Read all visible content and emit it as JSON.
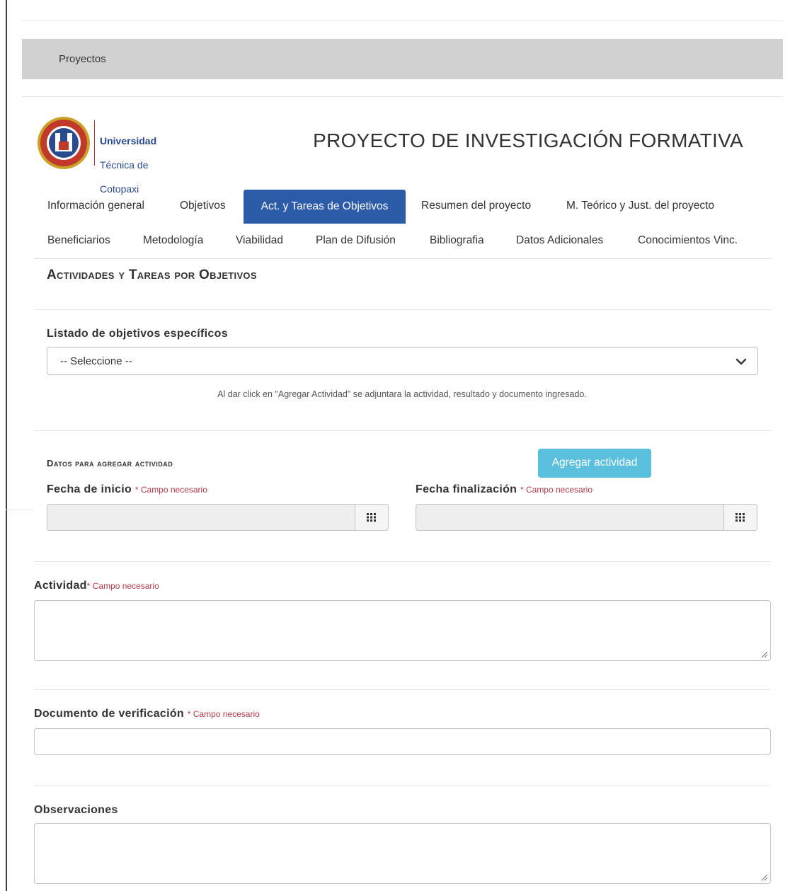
{
  "breadcrumb": {
    "link": "Proyectos"
  },
  "logo": {
    "line1": "Universidad",
    "line2": "Técnica de",
    "line3": "Cotopaxi"
  },
  "page_title": "PROYECTO DE INVESTIGACIÓN FORMATIVA",
  "tabs_row1": [
    "Información general",
    "Objetivos",
    "Act. y Tareas de Objetivos",
    "Resumen del proyecto",
    "M. Teórico y Just. del proyecto"
  ],
  "tabs_row2": [
    "Beneficiarios",
    "Metodología",
    "Viabilidad",
    "Plan de Difusión",
    "Bibliografia",
    "Datos Adicionales",
    "Conocimientos Vinc."
  ],
  "active_tab": "Act. y Tareas de Objetivos",
  "section_heading": "Actividades y Tareas por Objetivos",
  "objectives": {
    "label": "Listado de objetivos específicos",
    "selected": "-- Seleccione --",
    "hint": "Al dar click en \"Agregar Actividad\" se adjuntara la actividad, resultado y documento ingresado."
  },
  "activity_form": {
    "heading": "Datos para agregar actividad",
    "add_button": "Agregar actividad",
    "start_label": "Fecha de inicio",
    "end_label": "Fecha finalización",
    "required_text": "* Campo necesario",
    "activity_label": "Actividad",
    "activity_required": "* Campo necesario",
    "document_label": "Documento de verificación",
    "document_required": "* Campo necesario",
    "observations_label": "Observaciones"
  },
  "icons": {
    "chevron": "chevron-down-icon",
    "calendar": "calendar-grid-icon",
    "grip": "resize-grip-icon"
  },
  "colors": {
    "active_tab": "#2c5ca8",
    "add_button": "#5bc0de",
    "required": "#b03a48",
    "breadcrumb_bar": "#d1d1d1"
  }
}
